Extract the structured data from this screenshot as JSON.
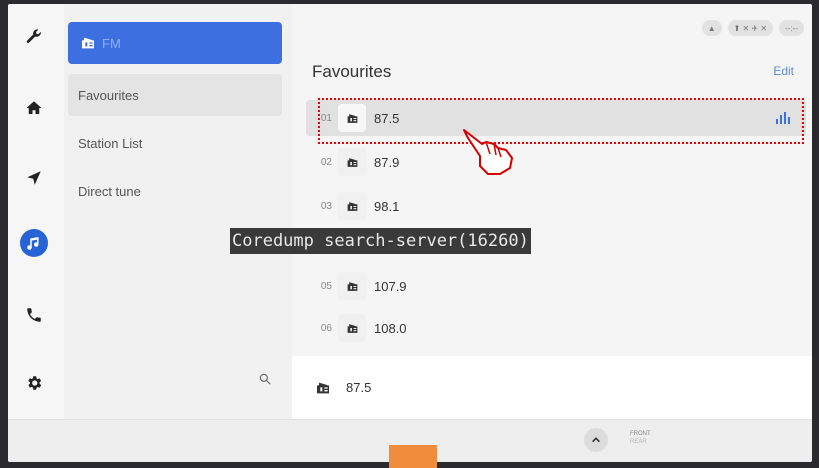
{
  "sidebar": {
    "icons": [
      {
        "name": "wrench-icon"
      },
      {
        "name": "home-icon"
      },
      {
        "name": "navigation-icon"
      },
      {
        "name": "music-note-icon",
        "active": true
      },
      {
        "name": "phone-icon"
      },
      {
        "name": "settings-icon"
      }
    ]
  },
  "source": {
    "label": "FM"
  },
  "menu": {
    "items": [
      {
        "label": "Favourites",
        "selected": true
      },
      {
        "label": "Station List"
      },
      {
        "label": "Direct tune"
      }
    ]
  },
  "header": {
    "title": "Favourites",
    "edit_label": "Edit"
  },
  "favourites": [
    {
      "num": "01",
      "freq": "87.5",
      "playing": true
    },
    {
      "num": "02",
      "freq": "87.9"
    },
    {
      "num": "03",
      "freq": "98.1"
    },
    {
      "num": "05",
      "freq": "107.9"
    },
    {
      "num": "06",
      "freq": "108.0"
    }
  ],
  "now_playing": {
    "freq": "87.5"
  },
  "bottom": {
    "front_label": "FRONT",
    "rear_label": "REAR"
  },
  "overlay": {
    "message": "Coredump search-server(16260)"
  },
  "colors": {
    "accent": "#3d6fe0",
    "highlight_border": "#e00000",
    "orange_tab": "#f08c3c"
  }
}
